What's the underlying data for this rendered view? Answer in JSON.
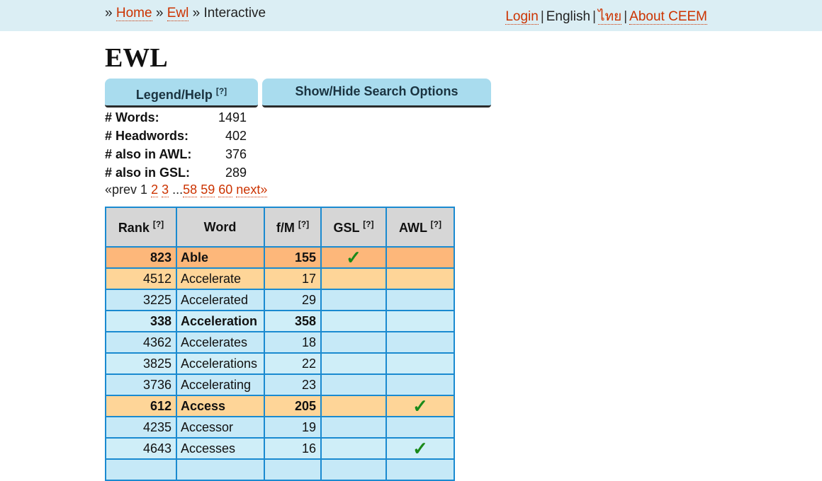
{
  "breadcrumb": {
    "sep1": "»",
    "home": "Home",
    "sep2": "»",
    "ewl": "Ewl",
    "sep3": "»",
    "current": "Interactive"
  },
  "toplinks": {
    "login": "Login",
    "english": "English",
    "thai": "ไทย",
    "about": "About CEEM"
  },
  "page_title": "EWL",
  "buttons": {
    "legend": "Legend/Help",
    "legend_sup": "[?]",
    "search": "Show/Hide Search Options"
  },
  "stats": [
    {
      "label": "# Words:",
      "value": "1491"
    },
    {
      "label": "# Headwords:",
      "value": "402"
    },
    {
      "label": "# also in AWL:",
      "value": "376"
    },
    {
      "label": "# also in GSL:",
      "value": "289"
    }
  ],
  "pager": {
    "prev": "«prev",
    "current": "1",
    "p2": "2",
    "p3": "3",
    "ellipsis": "...",
    "p58": "58",
    "p59": "59",
    "p60": "60",
    "next": "next»"
  },
  "table": {
    "headers": {
      "rank": "Rank",
      "word": "Word",
      "fm": "f/M",
      "gsl": "GSL",
      "awl": "AWL",
      "help": "[?]"
    },
    "check_icon": "check-mark-icon",
    "rows": [
      {
        "rank": "823",
        "word": "Able",
        "fm": "155",
        "gsl": "✓",
        "awl": ""
      },
      {
        "rank": "4512",
        "word": "Accelerate",
        "fm": "17",
        "gsl": "",
        "awl": ""
      },
      {
        "rank": "3225",
        "word": "Accelerated",
        "fm": "29",
        "gsl": "",
        "awl": ""
      },
      {
        "rank": "338",
        "word": "Acceleration",
        "fm": "358",
        "gsl": "",
        "awl": ""
      },
      {
        "rank": "4362",
        "word": "Accelerates",
        "fm": "18",
        "gsl": "",
        "awl": ""
      },
      {
        "rank": "3825",
        "word": "Accelerations",
        "fm": "22",
        "gsl": "",
        "awl": ""
      },
      {
        "rank": "3736",
        "word": "Accelerating",
        "fm": "23",
        "gsl": "",
        "awl": ""
      },
      {
        "rank": "612",
        "word": "Access",
        "fm": "205",
        "gsl": "",
        "awl": "✓"
      },
      {
        "rank": "4235",
        "word": "Accessor",
        "fm": "19",
        "gsl": "",
        "awl": ""
      },
      {
        "rank": "4643",
        "word": "Accesses",
        "fm": "16",
        "gsl": "",
        "awl": "✓"
      },
      {
        "rank": "",
        "word": "",
        "fm": "",
        "gsl": "",
        "awl": ""
      }
    ]
  }
}
